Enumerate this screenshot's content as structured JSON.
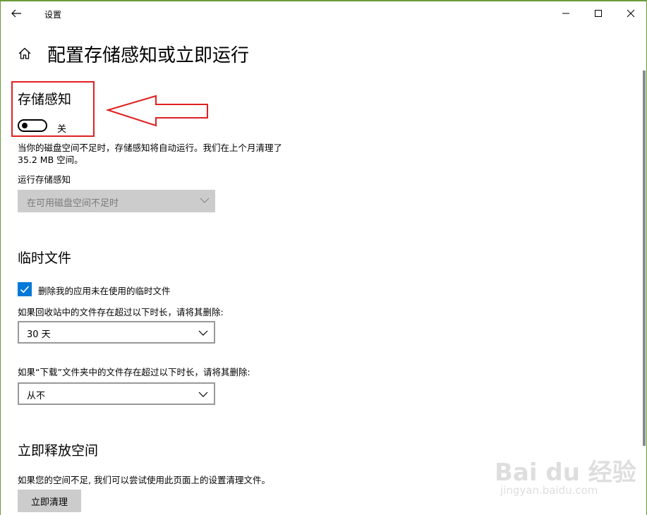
{
  "window": {
    "title": "设置"
  },
  "page": {
    "title": "配置存储感知或立即运行"
  },
  "storage_sense": {
    "title": "存储感知",
    "toggle_state": "关",
    "description_line1": "当你的磁盘空间不足时，存储感知将自动运行。我们在上个月清理了",
    "description_line2": "35.2 MB 空间。",
    "run_label": "运行存储感知",
    "run_selected": "在可用磁盘空间不足时"
  },
  "temp_files": {
    "title": "临时文件",
    "checkbox_label": "删除我的应用未在使用的临时文件",
    "checkbox_checked": true,
    "recycle_label": "如果回收站中的文件存在超过以下时长，请将其删除:",
    "recycle_selected": "30 天",
    "downloads_label": "如果“下载”文件夹中的文件存在超过以下时长，请将其删除:",
    "downloads_selected": "从不"
  },
  "free_space": {
    "title": "立即释放空间",
    "description": "如果您的空间不足, 我们可以尝试使用此页面上的设置清理文件。",
    "button_label": "立即清理"
  },
  "watermark": {
    "main": "Bai du 经验",
    "sub": "jingyan.baidu.com"
  },
  "colors": {
    "accent": "#0078d7",
    "annotation": "#e02020",
    "disabled_bg": "#cccccc"
  }
}
